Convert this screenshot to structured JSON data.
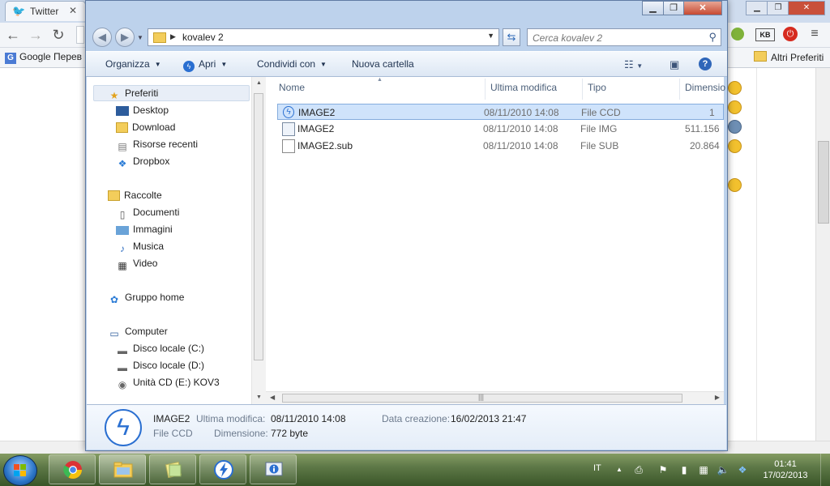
{
  "browser": {
    "tab_title": "Twitter",
    "bookmarks": {
      "google_label": "Google Перев",
      "other_label": "Altri Preferiti"
    },
    "ext_label": "KB"
  },
  "explorer": {
    "address": {
      "path": "kovalev 2"
    },
    "search": {
      "placeholder": "Cerca kovalev 2"
    },
    "commands": {
      "organize": "Organizza",
      "open": "Apri",
      "share": "Condividi con",
      "new_folder": "Nuova cartella"
    },
    "nav": {
      "favorites": "Preferiti",
      "desktop": "Desktop",
      "download": "Download",
      "recent": "Risorse recenti",
      "dropbox": "Dropbox",
      "libraries": "Raccolte",
      "documents": "Documenti",
      "pictures": "Immagini",
      "music": "Musica",
      "video": "Video",
      "homegroup": "Gruppo home",
      "computer": "Computer",
      "disk_c": "Disco locale (C:)",
      "disk_d": "Disco locale (D:)",
      "cd_e": "Unità CD (E:) KOV3"
    },
    "columns": {
      "name": "Nome",
      "modified": "Ultima modifica",
      "type": "Tipo",
      "size": "Dimensio"
    },
    "files": [
      {
        "name": "IMAGE2",
        "modified": "08/11/2010 14:08",
        "type": "File CCD",
        "size": "1",
        "icon": "daemon-tools-icon",
        "selected": true
      },
      {
        "name": "IMAGE2",
        "modified": "08/11/2010 14:08",
        "type": "File IMG",
        "size": "511.156",
        "icon": "disc-image-icon",
        "selected": false
      },
      {
        "name": "IMAGE2.sub",
        "modified": "08/11/2010 14:08",
        "type": "File SUB",
        "size": "20.864",
        "icon": "generic-file-icon",
        "selected": false
      }
    ],
    "details": {
      "name": "IMAGE2",
      "type": "File CCD",
      "modified_label": "Ultima modifica:",
      "modified_value": "08/11/2010 14:08",
      "size_label": "Dimensione:",
      "size_value": "772 byte",
      "created_label": "Data creazione:",
      "created_value": "16/02/2013 21:47"
    }
  },
  "taskbar": {
    "language": "IT",
    "time": "01:41",
    "date": "17/02/2013"
  },
  "colors": {
    "selection": "#cfe3fb",
    "accent": "#2a6fd1",
    "taskbar": "#3d5d22"
  }
}
